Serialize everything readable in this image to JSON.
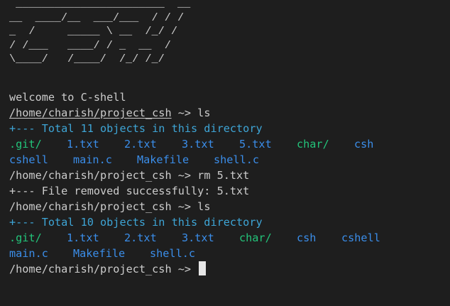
{
  "banner": " _______________________  __\n__  ____/__  ___/___  / / /\n_  /     _____ \\ __  /_/ /\n/ /___   ____/ / _  __  /\n\\____/   /____/  /_/ /_/",
  "welcome": "welcome to C-shell",
  "session": [
    {
      "prompt": "/home/charish/project_csh",
      "arrow": " ~> ",
      "command": "ls"
    },
    {
      "info": "+--- Total 11 objects in this directory"
    },
    {
      "row1": [
        ".git/",
        "1.txt",
        "2.txt",
        "3.txt",
        "5.txt",
        "char/",
        "csh"
      ]
    },
    {
      "row2": [
        "cshell",
        "main.c",
        "Makefile",
        "shell.c"
      ]
    },
    {
      "prompt": "/home/charish/project_csh",
      "arrow": " ~> ",
      "command": "rm 5.txt"
    },
    {
      "info": "+--- File removed successfully: 5.txt"
    },
    {
      "prompt": "/home/charish/project_csh",
      "arrow": " ~> ",
      "command": "ls"
    },
    {
      "info": "+--- Total 10 objects in this directory"
    },
    {
      "row1": [
        ".git/",
        "1.txt",
        "2.txt",
        "3.txt",
        "char/",
        "csh",
        "cshell"
      ]
    },
    {
      "row2": [
        "main.c",
        "Makefile",
        "shell.c"
      ]
    },
    {
      "prompt": "/home/charish/project_csh",
      "arrow": " ~> ",
      "command": ""
    }
  ],
  "colors": {
    "background": "#1e1e1e",
    "text": "#cccccc",
    "info": "#3ea5d6",
    "directory": "#23c47a",
    "file": "#3b8eea"
  }
}
